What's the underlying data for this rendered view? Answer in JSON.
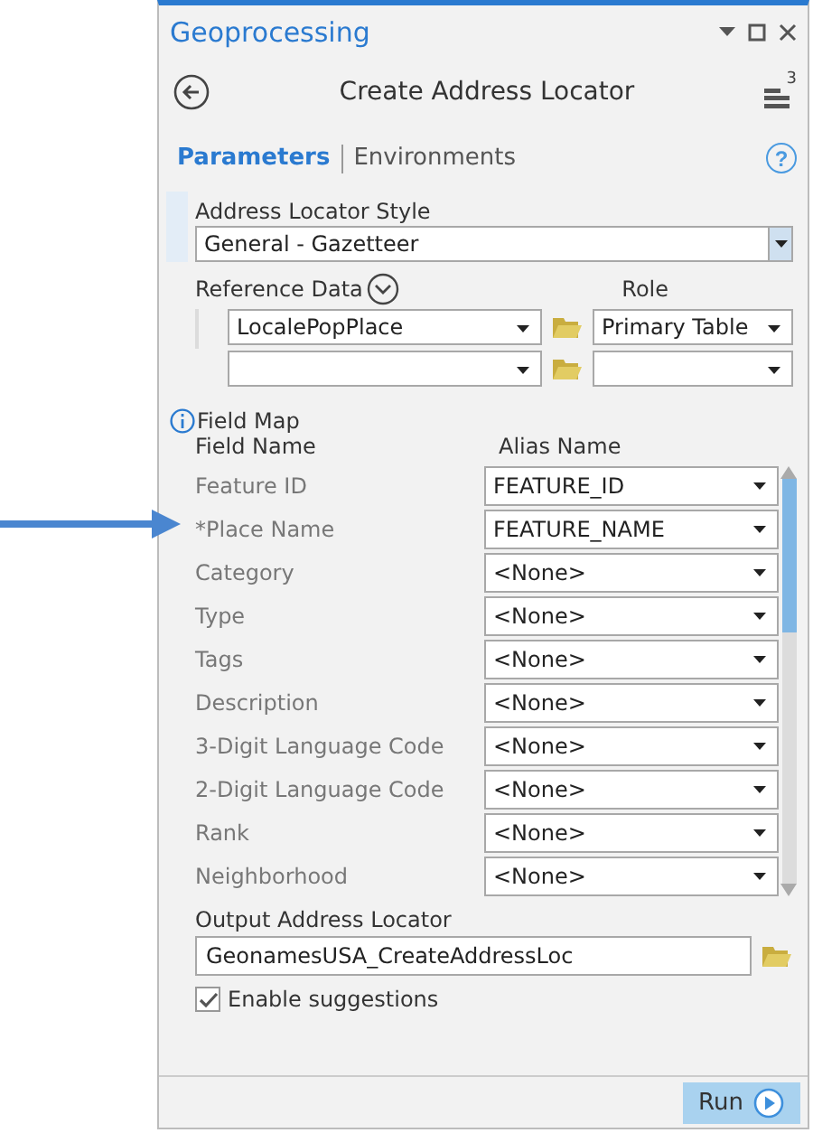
{
  "window": {
    "title": "Geoprocessing"
  },
  "tool": {
    "title": "Create Address Locator",
    "badge": "3"
  },
  "tabs": [
    {
      "label": "Parameters",
      "selected": true
    },
    {
      "label": "Environments",
      "selected": false
    }
  ],
  "help_button": {
    "label": "?"
  },
  "locator_style": {
    "label": "Address Locator Style",
    "value": "General - Gazetteer"
  },
  "reference_data": {
    "label": "Reference Data",
    "role_label": "Role",
    "rows": [
      {
        "data": "LocalePopPlace",
        "role": "Primary Table"
      },
      {}
    ]
  },
  "field_map": {
    "title": "Field Map",
    "columns": [
      "Field Name",
      "Alias Name"
    ],
    "rows": [
      {
        "name": "Feature ID",
        "value": "FEATURE_ID"
      },
      {
        "name": "*Place Name",
        "value": "FEATURE_NAME"
      },
      {
        "name": "Category",
        "value": "<None>"
      },
      {
        "name": "Type",
        "value": "<None>"
      },
      {
        "name": "Tags",
        "value": "<None>"
      },
      {
        "name": "Description",
        "value": "<None>"
      },
      {
        "name": "3-Digit Language Code",
        "value": "<None>"
      },
      {
        "name": "2-Digit Language Code",
        "value": "<None>"
      },
      {
        "name": "Rank",
        "value": "<None>"
      },
      {
        "name": "Neighborhood",
        "value": "<None>"
      }
    ]
  },
  "output": {
    "label": "Output Address Locator",
    "value": "GeonamesUSA_CreateAddressLoc"
  },
  "suggestions": {
    "label": "Enable suggestions",
    "checked": true
  },
  "run_button": {
    "label": "Run"
  }
}
